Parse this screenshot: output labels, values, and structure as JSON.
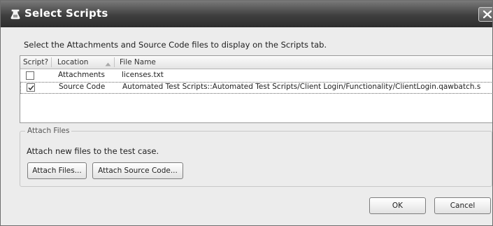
{
  "dialog": {
    "title": "Select Scripts",
    "icon": "flask-icon",
    "close_icon": "close-icon"
  },
  "instructions": "Select the Attachments and Source Code files to display on the Scripts tab.",
  "table": {
    "columns": [
      "Script?",
      "Location",
      "File Name"
    ],
    "sort_column": "Location",
    "sort_direction": "ascending",
    "rows": [
      {
        "checked": false,
        "location": "Attachments",
        "file_name": "licenses.txt"
      },
      {
        "checked": true,
        "location": "Source Code",
        "file_name": "Automated Test Scripts::Automated Test Scripts/Client Login/Functionality/ClientLogin.qawbatch.s"
      }
    ]
  },
  "attach_group": {
    "legend": "Attach Files",
    "description": "Attach new files to the test case.",
    "attach_files_label": "Attach Files...",
    "attach_source_label": "Attach Source Code..."
  },
  "footer": {
    "ok_label": "OK",
    "cancel_label": "Cancel"
  }
}
